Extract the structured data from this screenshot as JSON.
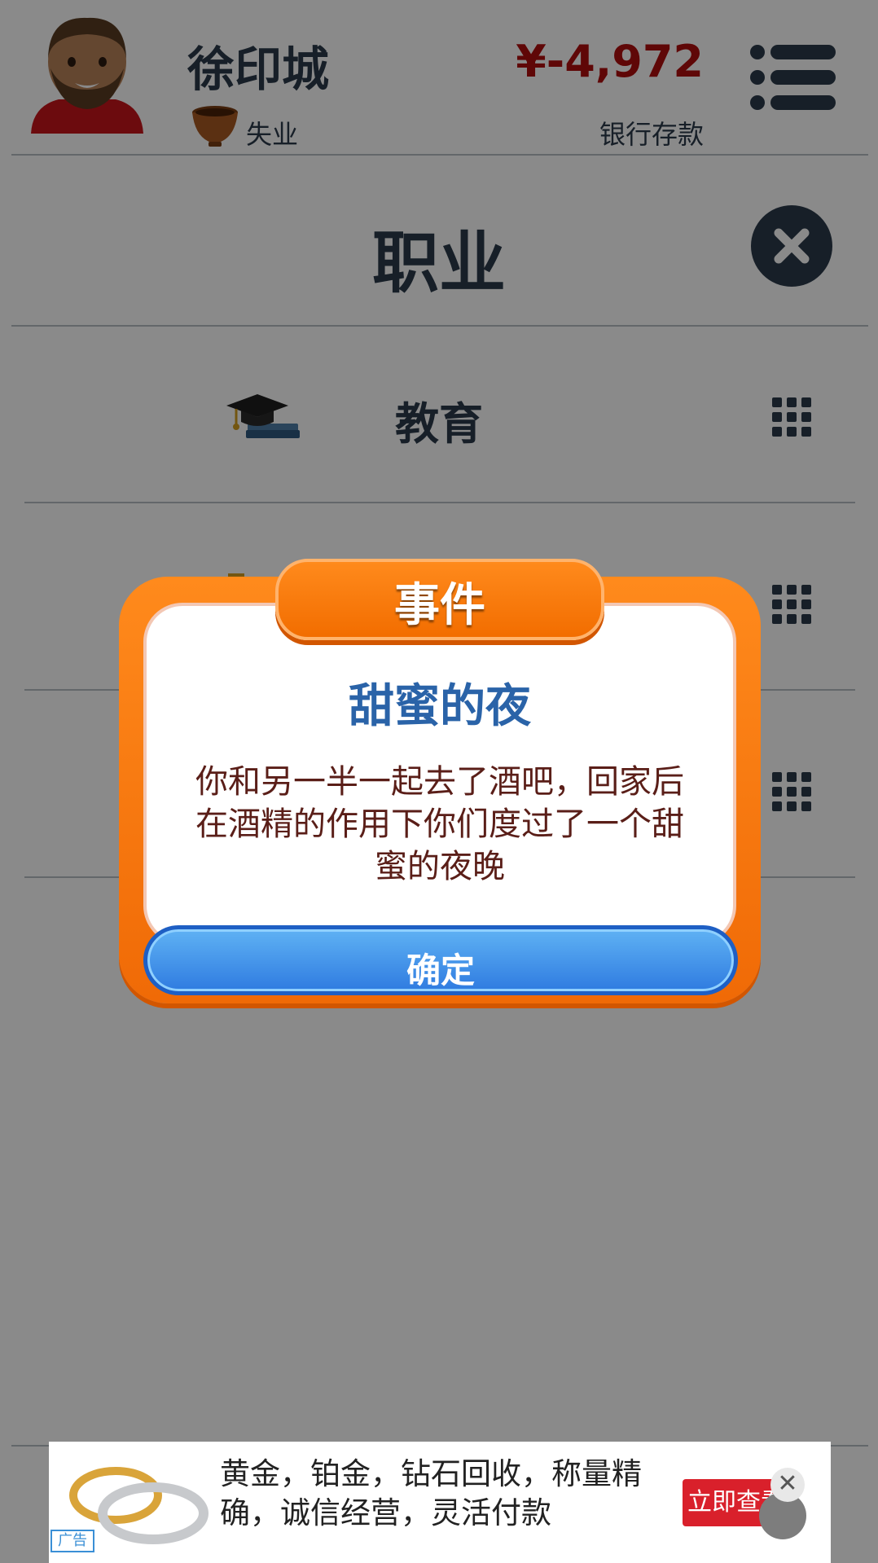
{
  "header": {
    "player_name": "徐印城",
    "job_status": "失业",
    "balance": "¥-4,972",
    "balance_label": "银行存款"
  },
  "section": {
    "title": "职业",
    "rows": [
      {
        "label": "教育"
      },
      {
        "label": ""
      },
      {
        "label": ""
      }
    ]
  },
  "dialog": {
    "tab_label": "事件",
    "event_title": "甜蜜的夜",
    "event_body": "你和另一半一起去了酒吧，回家后在酒精的作用下你们度过了一个甜蜜的夜晚",
    "ok_label": "确定"
  },
  "ad": {
    "text": "黄金，铂金，钻石回收，称量精确，诚信经营，灵活付款",
    "button_label": "立即查看",
    "tag": "广告",
    "close_glyph": "✕"
  },
  "colors": {
    "balance": "#b00d0d",
    "dialog_orange": "#f26d00",
    "ok_blue": "#2f7be0",
    "event_title": "#2a63a8"
  }
}
